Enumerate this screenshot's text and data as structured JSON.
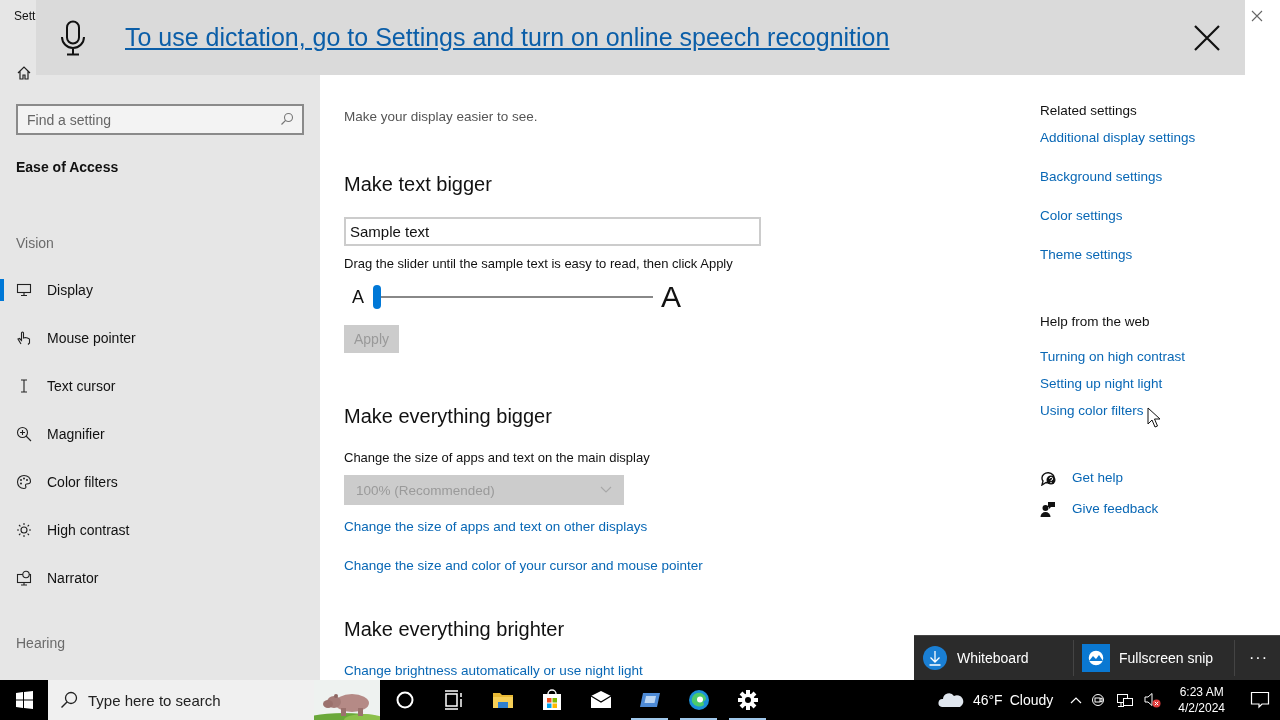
{
  "window": {
    "title": "Sett"
  },
  "dictation_banner": {
    "message": "To use dictation, go to Settings and turn on online speech recognition"
  },
  "sidebar": {
    "search": {
      "placeholder": "Find a setting"
    },
    "category": "Ease of Access",
    "sections": [
      {
        "heading": "Vision",
        "items": [
          {
            "label": "Display",
            "selected": true
          },
          {
            "label": "Mouse pointer",
            "selected": false
          },
          {
            "label": "Text cursor",
            "selected": false
          },
          {
            "label": "Magnifier",
            "selected": false
          },
          {
            "label": "Color filters",
            "selected": false
          },
          {
            "label": "High contrast",
            "selected": false
          },
          {
            "label": "Narrator",
            "selected": false
          }
        ]
      },
      {
        "heading": "Hearing"
      }
    ]
  },
  "page": {
    "subtitle": "Make your display easier to see.",
    "text_size": {
      "heading": "Make text bigger",
      "sample": {
        "value": "Sample text"
      },
      "hint": "Drag the slider until the sample text is easy to read, then click Apply",
      "slider": {
        "min_label": "A",
        "max_label": "A",
        "level": 0
      },
      "apply": {
        "label": "Apply",
        "disabled": true
      }
    },
    "scale": {
      "heading": "Make everything bigger",
      "label": "Change the size of apps and text on the main display",
      "dropdown": {
        "value": "100% (Recommended)",
        "disabled": true
      },
      "links": [
        "Change the size of apps and text on other displays",
        "Change the size and color of your cursor and mouse pointer"
      ]
    },
    "brightness": {
      "heading": "Make everything brighter",
      "links": [
        "Change brightness automatically or use night light"
      ]
    }
  },
  "related": {
    "heading": "Related settings",
    "links": [
      "Additional display settings",
      "Background settings",
      "Color settings",
      "Theme settings"
    ]
  },
  "help": {
    "heading": "Help from the web",
    "links": [
      "Turning on high contrast",
      "Setting up night light",
      "Using color filters"
    ]
  },
  "support": [
    {
      "label": "Get help"
    },
    {
      "label": "Give feedback"
    }
  ],
  "quick_actions": {
    "items": [
      {
        "label": "Whiteboard"
      },
      {
        "label": "Fullscreen snip"
      }
    ],
    "more": "···"
  },
  "taskbar": {
    "search": {
      "placeholder": "Type here to search"
    },
    "apps": [
      {
        "running": false
      },
      {
        "running": false
      },
      {
        "running": false
      },
      {
        "running": false
      },
      {
        "running": false
      },
      {
        "running": true
      },
      {
        "running": true
      },
      {
        "running": true
      }
    ],
    "weather": {
      "temperature": "46°F",
      "condition": "Cloudy"
    },
    "clock": {
      "time": "6:23 AM",
      "date": "4/2/2024"
    }
  }
}
